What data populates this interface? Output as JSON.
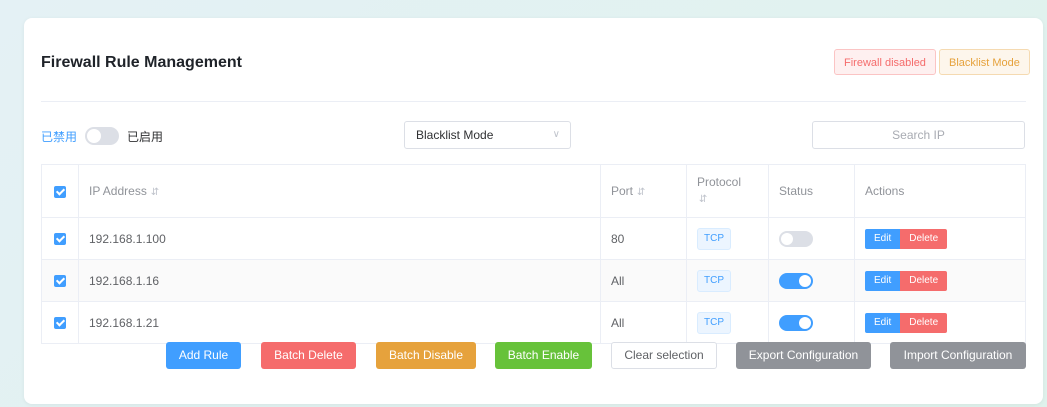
{
  "header": {
    "title": "Firewall Rule Management",
    "status_badge": "Firewall disabled",
    "mode_badge": "Blacklist Mode",
    "colors": {
      "danger": "#f56c6c",
      "warning": "#e6a23c"
    }
  },
  "controls": {
    "switch_off_label": "已禁用",
    "switch_on_label": "已启用",
    "switch_state": "off",
    "mode_select": "Blacklist Mode",
    "search_placeholder": "Search IP"
  },
  "table": {
    "columns": [
      "IP Address",
      "Port",
      "Protocol",
      "Status",
      "Actions"
    ],
    "rows": [
      {
        "ip": "192.168.1.100",
        "port": "80",
        "protocol": "TCP",
        "status": "off",
        "edit": "Edit",
        "delete": "Delete"
      },
      {
        "ip": "192.168.1.16",
        "port": "All",
        "protocol": "TCP",
        "status": "on",
        "edit": "Edit",
        "delete": "Delete"
      },
      {
        "ip": "192.168.1.21",
        "port": "All",
        "protocol": "TCP",
        "status": "on",
        "edit": "Edit",
        "delete": "Delete"
      }
    ],
    "accent": "#409eff"
  },
  "footer": {
    "add_rule": "Add Rule",
    "batch_delete": "Batch Delete",
    "batch_disable": "Batch Disable",
    "batch_enable": "Batch Enable",
    "clear_selection": "Clear selection",
    "export_config": "Export Configuration",
    "import_config": "Import Configuration"
  }
}
